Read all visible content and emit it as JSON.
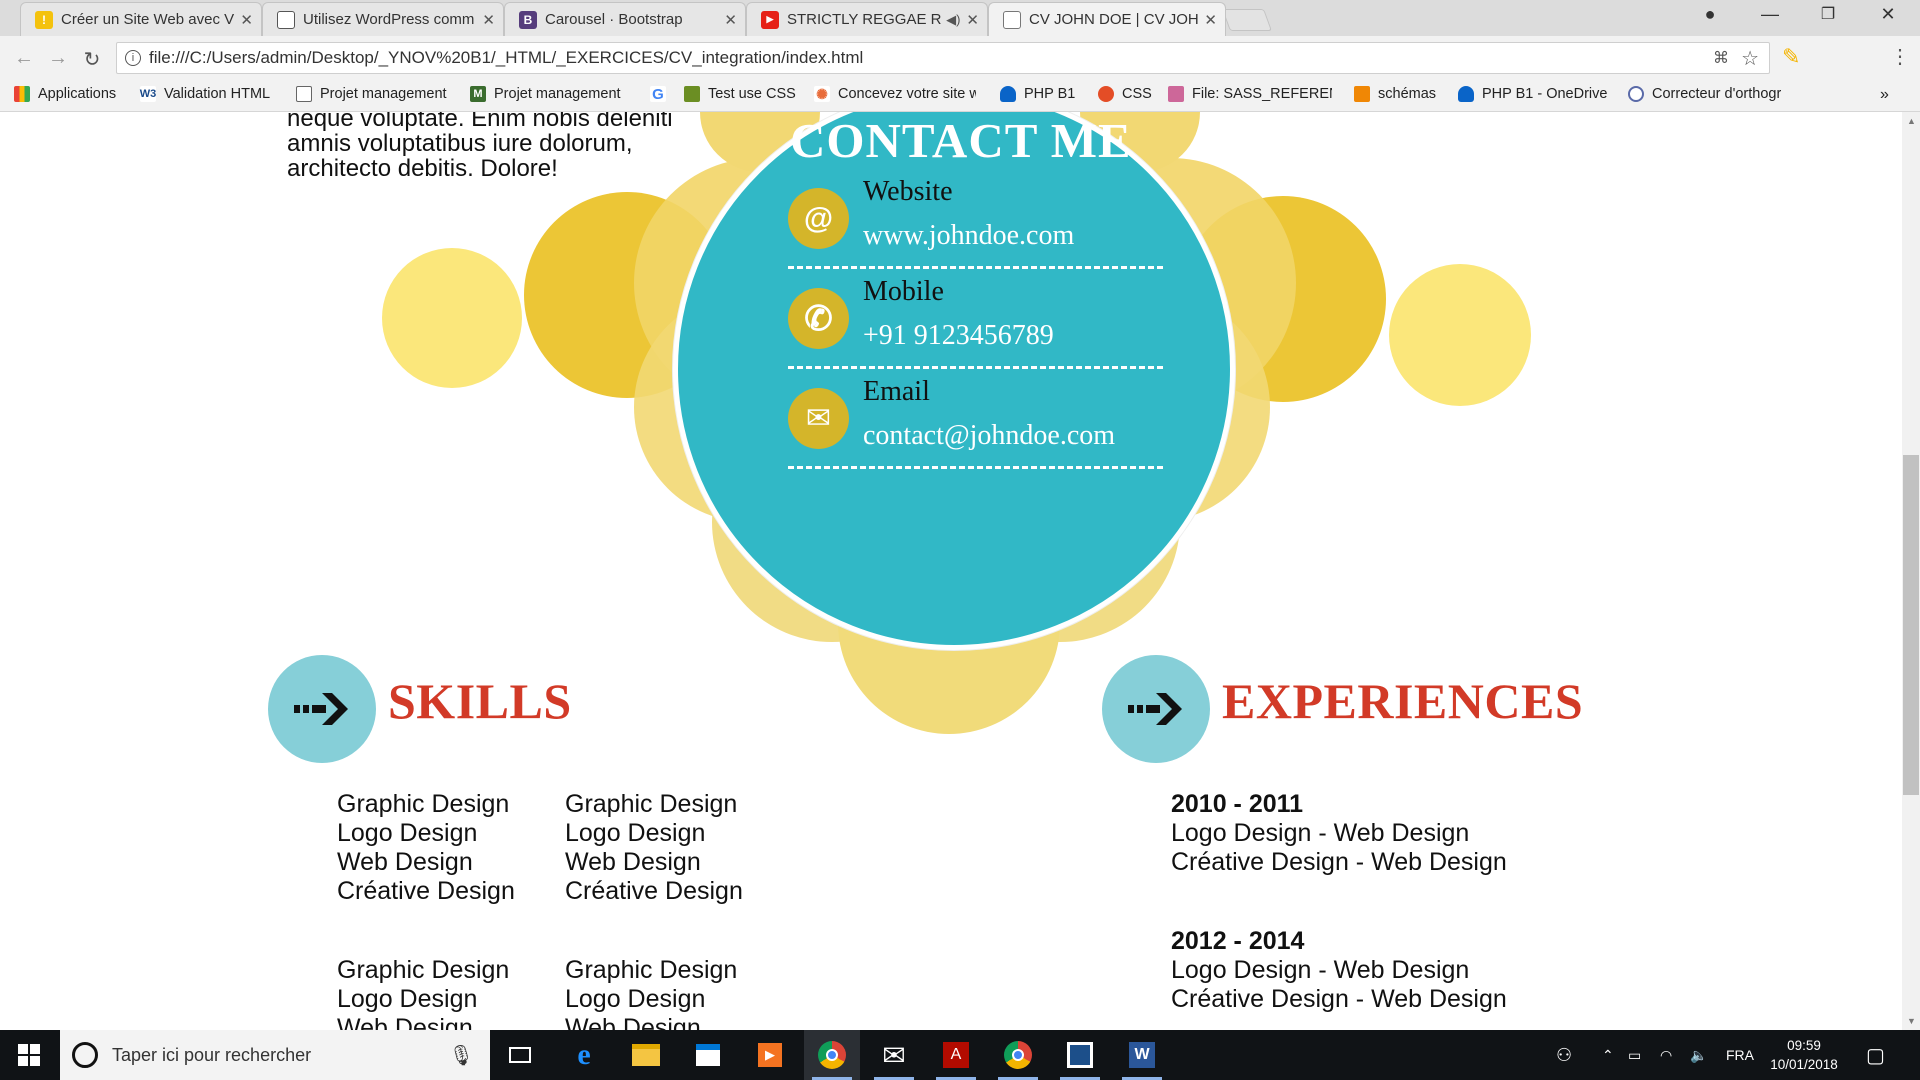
{
  "browser": {
    "tabs": [
      {
        "title": "Créer un Site Web avec V",
        "favicon": "warning-icon",
        "color": "#f4c20d"
      },
      {
        "title": "Utilisez WordPress comm",
        "favicon": "page-icon",
        "color": "#555555"
      },
      {
        "title": "Carousel · Bootstrap",
        "favicon": "bootstrap-icon",
        "color": "#563d7c"
      },
      {
        "title": "STRICTLY REGGAE RO",
        "favicon": "youtube-icon",
        "color": "#e62117"
      },
      {
        "title": "CV JOHN DOE | CV JOHN",
        "favicon": "document-icon",
        "color": "#777777"
      }
    ],
    "url": "file:///C:/Users/admin/Desktop/_YNOV%20B1/_HTML/_EXERCICES/CV_integration/index.html",
    "bookmarks": [
      {
        "label": "Applications",
        "icon": "apps-grid-icon"
      },
      {
        "label": "Validation HTML",
        "icon": "w3-icon"
      },
      {
        "label": "Projet management",
        "icon": "page-icon"
      },
      {
        "label": "Projet management",
        "icon": "trello-icon"
      },
      {
        "label": "",
        "icon": "google-icon"
      },
      {
        "label": "Test use CSS",
        "icon": "caniuse-icon"
      },
      {
        "label": "Concevez votre site w",
        "icon": "openclassrooms-icon"
      },
      {
        "label": "PHP B1",
        "icon": "onedrive-icon"
      },
      {
        "label": "CSS",
        "icon": "css-icon"
      },
      {
        "label": "File: SASS_REFERENC",
        "icon": "sass-icon"
      },
      {
        "label": "schémas",
        "icon": "drawio-icon"
      },
      {
        "label": "PHP B1 - OneDrive",
        "icon": "onedrive-icon"
      },
      {
        "label": "Correcteur d'orthogr",
        "icon": "corrector-icon"
      }
    ],
    "bookmarks_overflow": "»"
  },
  "page": {
    "intro_lines": [
      "neque voluptate. Enim nobis deleniti",
      "amnis voluptatibus iure dolorum,",
      "architecto debitis. Dolore!"
    ],
    "contact": {
      "title": "CONTACT ME",
      "items": [
        {
          "label": "Website",
          "value": "www.johndoe.com",
          "icon": "at-icon"
        },
        {
          "label": "Mobile",
          "value": "+91 9123456789",
          "icon": "phone-icon"
        },
        {
          "label": "Email",
          "value": "contact@johndoe.com",
          "icon": "envelope-icon"
        }
      ]
    },
    "skills": {
      "title": "SKILLS",
      "groups": [
        [
          "Graphic Design",
          "Logo Design",
          "Web Design",
          "Créative Design"
        ],
        [
          "Graphic Design",
          "Logo Design",
          "Web Design",
          "Créative Design"
        ],
        [
          "Graphic Design",
          "Logo Design",
          "Web Design"
        ],
        [
          "Graphic Design",
          "Logo Design",
          "Web Design"
        ]
      ]
    },
    "experiences": {
      "title": "EXPERIENCES",
      "entries": [
        {
          "years": "2010 - 2011",
          "lines": [
            "Logo Design - Web Design",
            "Créative Design - Web Design"
          ]
        },
        {
          "years": "2012 - 2014",
          "lines": [
            "Logo Design - Web Design",
            "Créative Design - Web Design"
          ]
        }
      ]
    },
    "colors": {
      "teal": "#31b8c6",
      "yellow": "#f0c93a",
      "red": "#d23a27",
      "light_teal": "#86cfd8"
    }
  },
  "taskbar": {
    "search_placeholder": "Taper ici pour rechercher",
    "apps": [
      "task-view-icon",
      "edge-icon",
      "file-explorer-icon",
      "store-icon",
      "media-player-icon",
      "chrome-icon",
      "mail-icon",
      "acrobat-icon",
      "chrome-icon",
      "vpn-icon",
      "word-icon"
    ],
    "language": "FRA",
    "time": "09:59",
    "date": "10/01/2018"
  }
}
